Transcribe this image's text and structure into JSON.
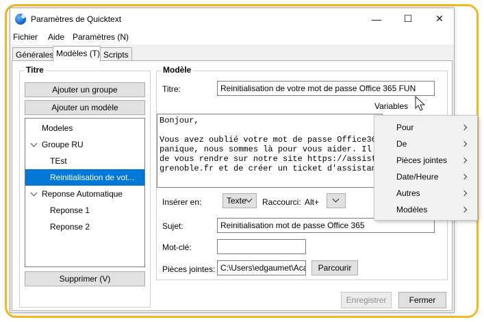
{
  "window": {
    "title": "Paramètres de Quicktext",
    "controls": {
      "minimize": "—",
      "maximize": "☐",
      "close": "✕"
    }
  },
  "menubar": {
    "items": [
      "Fichier",
      "Aide",
      "Paramètres (N)"
    ]
  },
  "tabs": [
    "Générales",
    "Modèles (T)",
    "Scripts"
  ],
  "left_panel": {
    "title": "Titre",
    "add_group_button": "Ajouter un groupe",
    "add_model_button": "Ajouter un modèle",
    "tree": [
      "Modeles",
      "Groupe RU",
      "TEst",
      "Reinitialisation de vot...",
      "Reponse Automatique",
      "Reponse 1",
      "Reponse 2"
    ],
    "delete_button": "Supprimer (V)"
  },
  "right_panel": {
    "title": "Modèle",
    "title_label": "Titre:",
    "title_value": "Reinitialisation de votre mot de passe Office 365 FUN",
    "variables_label": "Variables",
    "body_lines": [
      "Bonjour,",
      "",
      "Vous avez oublié votre mot de passe Office365",
      "panique, nous sommes là pour vous aider. Il vo",
      "de vous rendre sur notre site https://assistanc",
      "grenoble.fr et de créer un ticket d'assistance"
    ],
    "insert_label": "Insérer en:",
    "insert_value": "Texte",
    "shortcut_label": "Raccourci:",
    "shortcut_value": "Alt+",
    "subject_label": "Sujet:",
    "subject_value": "Reinitialisation mot de passe Office 365",
    "keyword_label": "Mot-clé:",
    "keyword_value": "",
    "attachments_label": "Pièces jointes:",
    "attachments_value": "C:\\Users\\edgaumet\\Aca",
    "browse_button": "Parcourir"
  },
  "footer": {
    "save_button": "Enregistrer",
    "close_button": "Fermer"
  },
  "context_menu": {
    "items": [
      "Pour",
      "De",
      "Pièces jointes",
      "Date/Heure",
      "Autres",
      "Modèles"
    ]
  },
  "colors": {
    "highlight": "#0078d7",
    "frame": "#f5b81c"
  }
}
